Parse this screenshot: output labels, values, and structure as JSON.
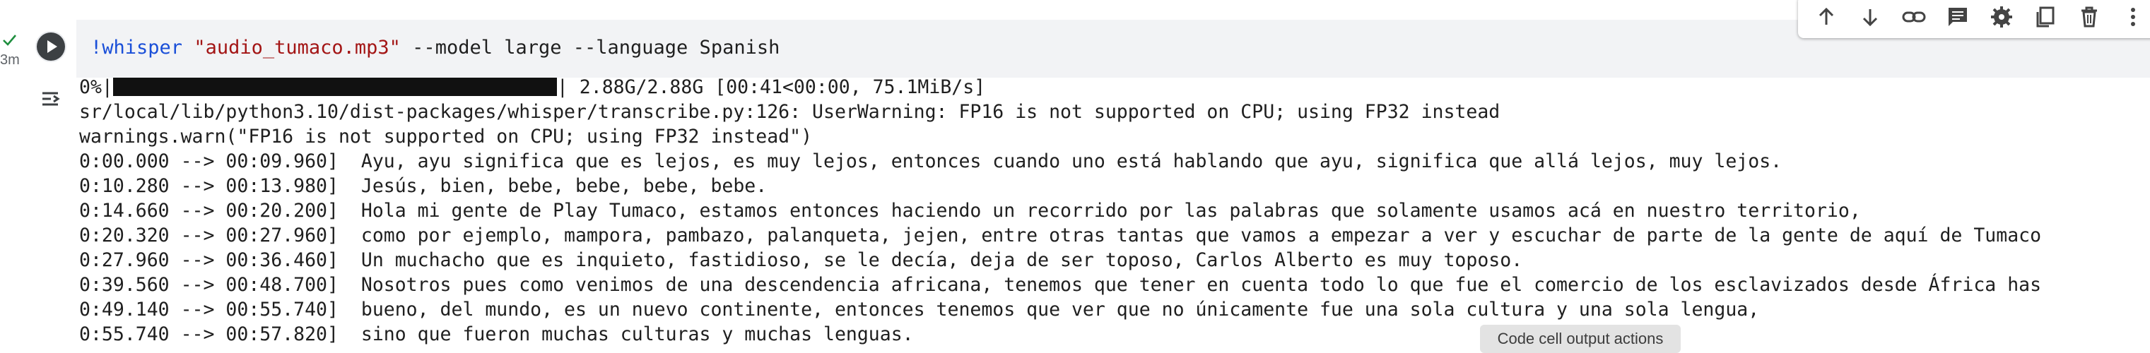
{
  "cell": {
    "status_check": "✓",
    "elapsed": "3m",
    "code_parts": {
      "bang": "!whisper",
      "space1": " ",
      "file": "\"audio_tumaco.mp3\"",
      "args": " --model large --language Spanish"
    }
  },
  "toolbar_icons": [
    "arrow-up-icon",
    "arrow-down-icon",
    "link-icon",
    "comment-icon",
    "gear-icon",
    "copy-icon",
    "trash-icon",
    "more-vert-icon"
  ],
  "output": {
    "progress": {
      "prefix": "0%|",
      "fill_fraction": 1.0,
      "suffix": "| 2.88G/2.88G [00:41<00:00, 75.1MiB/s]"
    },
    "lines": [
      "sr/local/lib/python3.10/dist-packages/whisper/transcribe.py:126: UserWarning: FP16 is not supported on CPU; using FP32 instead",
      "warnings.warn(\"FP16 is not supported on CPU; using FP32 instead\")",
      "0:00.000 --> 00:09.960]  Ayu, ayu significa que es lejos, es muy lejos, entonces cuando uno está hablando que ayu, significa que allá lejos, muy lejos.",
      "0:10.280 --> 00:13.980]  Jesús, bien, bebe, bebe, bebe, bebe.",
      "0:14.660 --> 00:20.200]  Hola mi gente de Play Tumaco, estamos entonces haciendo un recorrido por las palabras que solamente usamos acá en nuestro territorio,",
      "0:20.320 --> 00:27.960]  como por ejemplo, mampora, pambazo, palanqueta, jejen, entre otras tantas que vamos a empezar a ver y escuchar de parte de la gente de aquí de Tumaco",
      "0:27.960 --> 00:36.460]  Un muchacho que es inquieto, fastidioso, se le decía, deja de ser toposo, Carlos Alberto es muy toposo.",
      "0:39.560 --> 00:48.700]  Nosotros pues como venimos de una descendencia africana, tenemos que tener en cuenta todo lo que fue el comercio de los esclavizados desde África has",
      "0:49.140 --> 00:55.740]  bueno, del mundo, es un nuevo continente, entonces tenemos que ver que no únicamente fue una sola cultura y una sola lengua,",
      "0:55.740 --> 00:57.820]  sino que fueron muchas culturas y muchas lenguas."
    ]
  },
  "tooltip": "Code cell output actions"
}
